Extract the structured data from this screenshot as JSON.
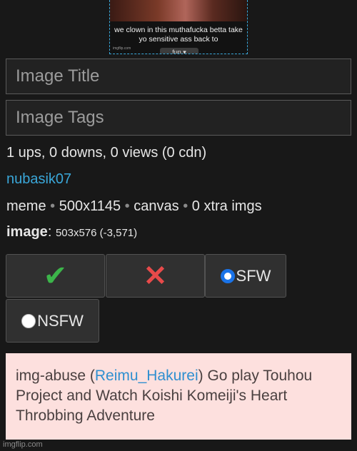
{
  "preview": {
    "caption": "we clown in this muthafucka betta take yo sensitive ass back to",
    "pill_text": "fun ▾",
    "watermark": "imgflip.com"
  },
  "form": {
    "title_placeholder": "Image Title",
    "tags_placeholder": "Image Tags"
  },
  "stats": "1 ups, 0 downs, 0 views (0 cdn)",
  "uploader": "nubasik07",
  "meta": {
    "type": "meme",
    "dimensions": "500x1145",
    "render": "canvas",
    "extra_imgs": "0 xtra imgs",
    "separator": "•"
  },
  "image_info": {
    "label": "image",
    "colon": ":",
    "value": "503x576 (-3,571)"
  },
  "moderation": {
    "approve_icon": "✔",
    "reject_icon": "✕",
    "sfw_label": "SFW",
    "nsfw_label": "NSFW",
    "approve_color": "#3cb54a",
    "reject_color": "#e84a4a",
    "sfw_selected": true
  },
  "abuse": {
    "prefix": "img-abuse (",
    "user": "Reimu_Hakurei",
    "suffix": ") Go play Touhou Project and Watch Koishi Komeiji's Heart Throbbing Adventure"
  },
  "footer": "imgflip.com"
}
